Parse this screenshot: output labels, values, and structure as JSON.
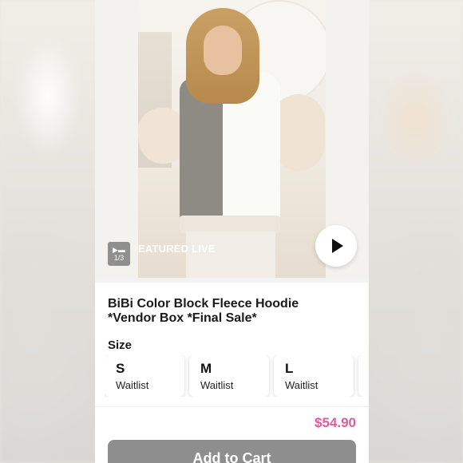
{
  "media": {
    "featured_label": "FEATURED LIVE",
    "visible_featured_text": "EATURED LIVE",
    "photo_counter": "1/3",
    "live_icon": "video-icon",
    "play_icon": "play-icon"
  },
  "product": {
    "title": "BiBi Color Block Fleece Hoodie *Vendor Box *Final Sale*",
    "price": "$54.90",
    "price_color": "#e05a9c"
  },
  "size_section": {
    "label": "Size",
    "options": [
      {
        "code": "S",
        "status": "Waitlist"
      },
      {
        "code": "M",
        "status": "Waitlist"
      },
      {
        "code": "L",
        "status": "Waitlist"
      }
    ]
  },
  "cart": {
    "button_label": "Add to Cart",
    "button_color": "#8e8e8e"
  }
}
